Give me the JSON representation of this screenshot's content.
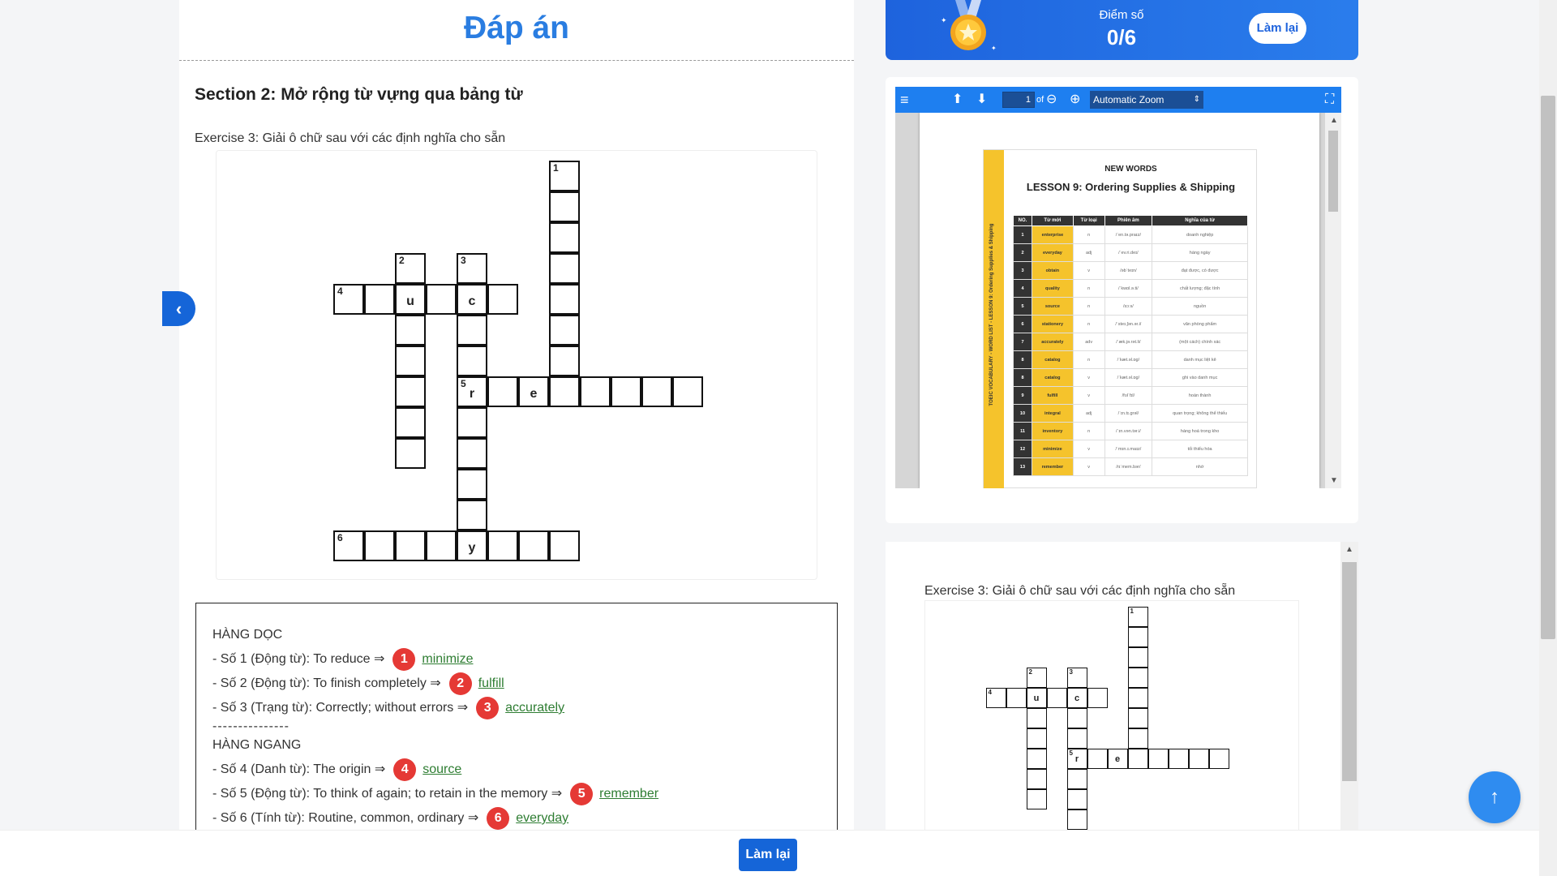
{
  "header": {
    "title": "Đáp án"
  },
  "section": {
    "title": "Section 2: Mở rộng từ vựng qua bảng từ",
    "exercise_label": "Exercise 3: Giải ô chữ sau với các định nghĩa cho sẵn"
  },
  "crossword": {
    "cells": [
      {
        "c": 7,
        "r": 0,
        "n": "1",
        "ch": ""
      },
      {
        "c": 7,
        "r": 1,
        "n": "",
        "ch": ""
      },
      {
        "c": 7,
        "r": 2,
        "n": "",
        "ch": ""
      },
      {
        "c": 7,
        "r": 3,
        "n": "",
        "ch": ""
      },
      {
        "c": 7,
        "r": 4,
        "n": "",
        "ch": ""
      },
      {
        "c": 7,
        "r": 5,
        "n": "",
        "ch": ""
      },
      {
        "c": 7,
        "r": 6,
        "n": "",
        "ch": ""
      },
      {
        "c": 7,
        "r": 7,
        "n": "",
        "ch": ""
      },
      {
        "c": 2,
        "r": 3,
        "n": "2",
        "ch": ""
      },
      {
        "c": 2,
        "r": 4,
        "n": "",
        "ch": "u"
      },
      {
        "c": 2,
        "r": 5,
        "n": "",
        "ch": ""
      },
      {
        "c": 2,
        "r": 6,
        "n": "",
        "ch": ""
      },
      {
        "c": 2,
        "r": 7,
        "n": "",
        "ch": ""
      },
      {
        "c": 2,
        "r": 8,
        "n": "",
        "ch": ""
      },
      {
        "c": 2,
        "r": 9,
        "n": "",
        "ch": ""
      },
      {
        "c": 4,
        "r": 3,
        "n": "3",
        "ch": ""
      },
      {
        "c": 4,
        "r": 4,
        "n": "",
        "ch": "c"
      },
      {
        "c": 4,
        "r": 5,
        "n": "",
        "ch": ""
      },
      {
        "c": 4,
        "r": 6,
        "n": "",
        "ch": ""
      },
      {
        "c": 4,
        "r": 7,
        "n": "5",
        "ch": "r"
      },
      {
        "c": 4,
        "r": 8,
        "n": "",
        "ch": ""
      },
      {
        "c": 4,
        "r": 9,
        "n": "",
        "ch": ""
      },
      {
        "c": 4,
        "r": 10,
        "n": "",
        "ch": ""
      },
      {
        "c": 4,
        "r": 11,
        "n": "",
        "ch": ""
      },
      {
        "c": 4,
        "r": 12,
        "n": "",
        "ch": "y"
      },
      {
        "c": 0,
        "r": 4,
        "n": "4",
        "ch": ""
      },
      {
        "c": 1,
        "r": 4,
        "n": "",
        "ch": ""
      },
      {
        "c": 3,
        "r": 4,
        "n": "",
        "ch": ""
      },
      {
        "c": 5,
        "r": 4,
        "n": "",
        "ch": ""
      },
      {
        "c": 5,
        "r": 7,
        "n": "",
        "ch": ""
      },
      {
        "c": 6,
        "r": 7,
        "n": "",
        "ch": "e"
      },
      {
        "c": 8,
        "r": 7,
        "n": "",
        "ch": ""
      },
      {
        "c": 9,
        "r": 7,
        "n": "",
        "ch": ""
      },
      {
        "c": 10,
        "r": 7,
        "n": "",
        "ch": ""
      },
      {
        "c": 11,
        "r": 7,
        "n": "",
        "ch": ""
      },
      {
        "c": 0,
        "r": 12,
        "n": "6",
        "ch": ""
      },
      {
        "c": 1,
        "r": 12,
        "n": "",
        "ch": ""
      },
      {
        "c": 2,
        "r": 12,
        "n": "",
        "ch": ""
      },
      {
        "c": 3,
        "r": 12,
        "n": "",
        "ch": ""
      },
      {
        "c": 5,
        "r": 12,
        "n": "",
        "ch": ""
      },
      {
        "c": 6,
        "r": 12,
        "n": "",
        "ch": ""
      },
      {
        "c": 7,
        "r": 12,
        "n": "",
        "ch": ""
      }
    ]
  },
  "answers": {
    "vertical_heading": "HÀNG DỌC",
    "horizontal_heading": "HÀNG NGANG",
    "divider": "---------------",
    "vertical": [
      {
        "prompt": "- Số 1 (Động từ): To reduce ⇒",
        "badge": "1",
        "answer": "minimize"
      },
      {
        "prompt": "- Số 2 (Động từ): To finish completely ⇒",
        "badge": "2",
        "answer": "fulfill"
      },
      {
        "prompt": "- Số 3 (Trạng từ): Correctly; without errors ⇒",
        "badge": "3",
        "answer": "accurately"
      }
    ],
    "horizontal": [
      {
        "prompt": "- Số 4 (Danh từ): The origin ⇒",
        "badge": "4",
        "answer": "source"
      },
      {
        "prompt": "- Số 5 (Động từ): To think of again; to retain in the memory ⇒",
        "badge": "5",
        "answer": "remember"
      },
      {
        "prompt": "- Số 6 (Tính từ): Routine, common, ordinary ⇒",
        "badge": "6",
        "answer": "everyday"
      }
    ]
  },
  "score": {
    "label": "Điểm số",
    "value": "0/6",
    "retry_label": "Làm lại"
  },
  "pdf_viewer": {
    "page_number": "1",
    "of_label": "of",
    "zoom": "Automatic Zoom",
    "doc_heading": "NEW WORDS",
    "doc_title": "LESSON 9: Ordering Supplies & Shipping",
    "doc_sidebar": "TOEIC VOCABULARY - WORD LIST - LESSON 9: Ordering Supplies & Shipping",
    "table_headers": [
      "NO.",
      "Từ mới",
      "Từ loại",
      "Phiên âm",
      "Nghĩa của từ"
    ],
    "rows": [
      [
        "1",
        "enterprise",
        "n",
        "/ˈen.tə.praɪz/",
        "doanh nghiệp"
      ],
      [
        "2",
        "everyday",
        "adj",
        "/ˈev.ri.deɪ/",
        "hàng ngày"
      ],
      [
        "3",
        "obtain",
        "v",
        "/əbˈteɪn/",
        "đạt được, có được"
      ],
      [
        "4",
        "quality",
        "n",
        "/ˈkwɒl.ə.ti/",
        "chất lượng; đặc tính"
      ],
      [
        "5",
        "source",
        "n",
        "/sɔːs/",
        "nguồn"
      ],
      [
        "6",
        "stationery",
        "n",
        "/ˈsteɪ.ʃən.ər.i/",
        "văn phòng phẩm"
      ],
      [
        "7",
        "accurately",
        "adv",
        "/ˈæk.jə.rət.li/",
        "(một cách) chính xác"
      ],
      [
        "8",
        "catalog",
        "n",
        "/ˈkæt.əl.ɒɡ/",
        "danh mục liệt kê"
      ],
      [
        "8",
        "catalog",
        "v",
        "/ˈkæt.əl.ɒɡ/",
        "ghi vào danh mục"
      ],
      [
        "9",
        "fulfill",
        "v",
        "/fʊlˈfɪl/",
        "hoàn thành"
      ],
      [
        "10",
        "integral",
        "adj",
        "/ˈɪn.tɪ.ɡrəl/",
        "quan trọng; không thể thiếu"
      ],
      [
        "11",
        "inventory",
        "n",
        "/ˈɪn.vən.tər.i/",
        "hàng hoá trong kho"
      ],
      [
        "12",
        "minimize",
        "v",
        "/ˈmɪn.ɪ.maɪz/",
        "tối thiểu hóa"
      ],
      [
        "13",
        "remember",
        "v",
        "/rɪˈmem.bər/",
        "nhớ"
      ]
    ]
  },
  "preview": {
    "exercise_label": "Exercise 3: Giải ô chữ sau với các định nghĩa cho sẵn"
  },
  "footer": {
    "retry_label": "Làm lại"
  },
  "icons": {
    "prev": "chevron-left-icon",
    "menu": "hamburger-icon",
    "up": "arrow-up-icon",
    "down": "arrow-down-icon",
    "zoom_out": "zoom-out-icon",
    "zoom_in": "zoom-in-icon",
    "fullscreen": "fullscreen-icon",
    "medal": "medal-icon",
    "scroll_top": "arrow-up-icon"
  },
  "colors": {
    "primary": "#1565d8",
    "title": "#2a7de1",
    "badge": "#e53935",
    "answer": "#2e7d32",
    "doc_accent": "#f5c32c"
  }
}
